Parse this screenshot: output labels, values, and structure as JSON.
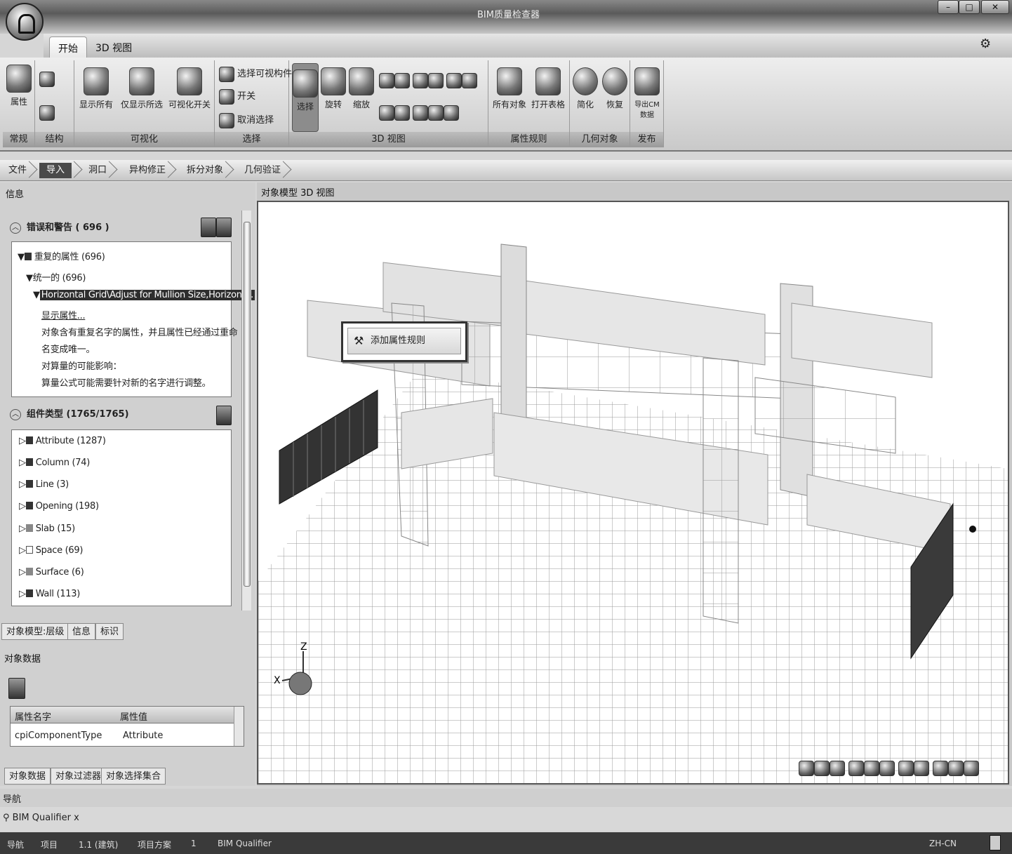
{
  "window": {
    "title": "BIM质量检查器",
    "minimize": "–",
    "maximize": "□",
    "close": "✕"
  },
  "ribbon_tabs": [
    "开始",
    "3D 视图"
  ],
  "ribbon": {
    "groups": {
      "general": "常规",
      "structure": "结构",
      "visibility": "可视化",
      "selection": "选择",
      "view3d": "3D 视图",
      "property_rules": "属性规则",
      "geometry": "几何对象",
      "publish": "发布"
    },
    "buttons": {
      "properties": "属性",
      "show_all": "显示所有",
      "show_selected_only": "仅显示所选",
      "visibility_toggle": "可视化开关",
      "select_visible": "选择可视构件",
      "toggle": "开关",
      "deselect": "取消选择",
      "select": "选择",
      "rotate": "旋转",
      "zoom": "缩放",
      "all_objects": "所有对象",
      "open_table": "打开表格",
      "simplify": "简化",
      "restore": "恢复",
      "publish_cm": "导出CM数据"
    }
  },
  "breadcrumb": [
    "文件",
    "导入",
    "洞口",
    "异构修正",
    "拆分对象",
    "几何验证"
  ],
  "left_panel": {
    "title": "信息",
    "errors_section": "错误和警告 ( 696 )",
    "error_tree": [
      "重复的属性 (696)",
      "统一的 (696)",
      "Horizontal Grid\\Adjust for Mullion Size,Horizont...",
      "显示属性...",
      "对象含有重复名字的属性，并且属性已经通过重命",
      "名变成唯一。",
      "对算量的可能影响：",
      "算量公式可能需要针对新的名字进行调整。"
    ],
    "types_section": "组件类型 (1765/1765)",
    "component_types": [
      "Attribute (1287)",
      "Column (74)",
      "Line (3)",
      "Opening (198)",
      "Slab (15)",
      "Space (69)",
      "Surface (6)",
      "Wall (113)"
    ],
    "tabs": [
      "对象模型:层级",
      "信息",
      "标识"
    ],
    "object_data_title": "对象数据",
    "table_headers": [
      "属性名字",
      "属性值"
    ],
    "table_rows": [
      [
        "cpiComponentType",
        "Attribute"
      ]
    ],
    "bottom_tabs": [
      "对象数据",
      "对象过滤器",
      "对象选择集合"
    ]
  },
  "viewport": {
    "title": "对象模型 3D 视图",
    "context_menu": "添加属性规则",
    "axis_z": "Z",
    "axis_x": "X"
  },
  "status": {
    "nav": "导航",
    "plugin_tab": "BIM Qualifier",
    "plugin_close": "x"
  },
  "taskbar": {
    "items": [
      "导航",
      "项目",
      "1.1 (建筑)",
      "项目方案",
      "1",
      "BIM Qualifier"
    ],
    "lang": "ZH-CN"
  }
}
